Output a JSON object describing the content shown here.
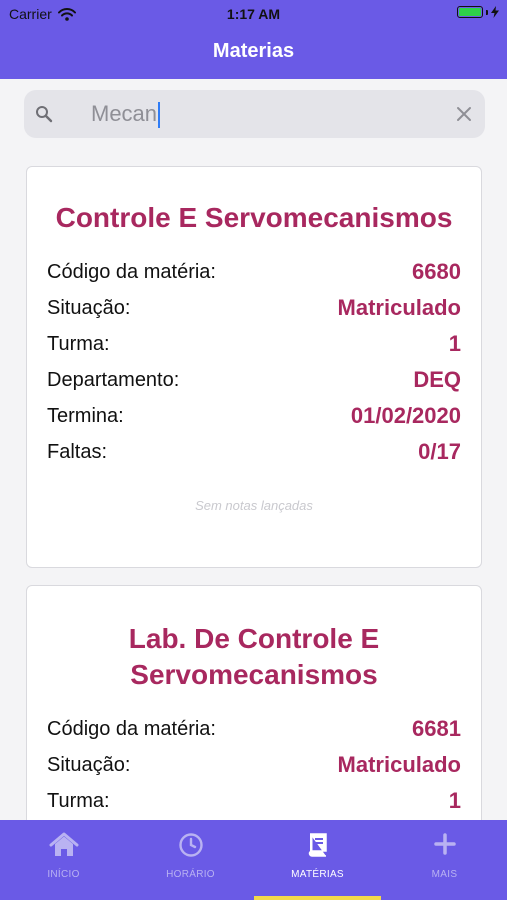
{
  "status_bar": {
    "carrier": "Carrier",
    "time": "1:17 AM"
  },
  "nav": {
    "title": "Materias"
  },
  "search": {
    "value": "Mecan",
    "icon": "search-icon",
    "clear_icon": "clear-icon"
  },
  "courses": [
    {
      "title": "Controle E Servomecanismos",
      "rows": [
        {
          "label": "Código da matéria:",
          "value": "6680"
        },
        {
          "label": "Situação:",
          "value": "Matriculado"
        },
        {
          "label": "Turma:",
          "value": "1"
        },
        {
          "label": "Departamento:",
          "value": "DEQ"
        },
        {
          "label": "Termina:",
          "value": "01/02/2020"
        },
        {
          "label": "Faltas:",
          "value": "0/17"
        }
      ],
      "note": "Sem notas lançadas"
    },
    {
      "title": "Lab. De Controle E Servomecanismos",
      "rows": [
        {
          "label": "Código da matéria:",
          "value": "6681"
        },
        {
          "label": "Situação:",
          "value": "Matriculado"
        },
        {
          "label": "Turma:",
          "value": "1"
        }
      ]
    }
  ],
  "tabs": [
    {
      "label": "INÍCIO",
      "icon": "home-icon"
    },
    {
      "label": "HORÁRIO",
      "icon": "clock-icon"
    },
    {
      "label": "MATÉRIAS",
      "icon": "book-icon",
      "active": true
    },
    {
      "label": "MAIS",
      "icon": "plus-icon"
    }
  ],
  "colors": {
    "primary": "#6a5ae6",
    "accent": "#a8285f",
    "indicator": "#f2d94a"
  }
}
